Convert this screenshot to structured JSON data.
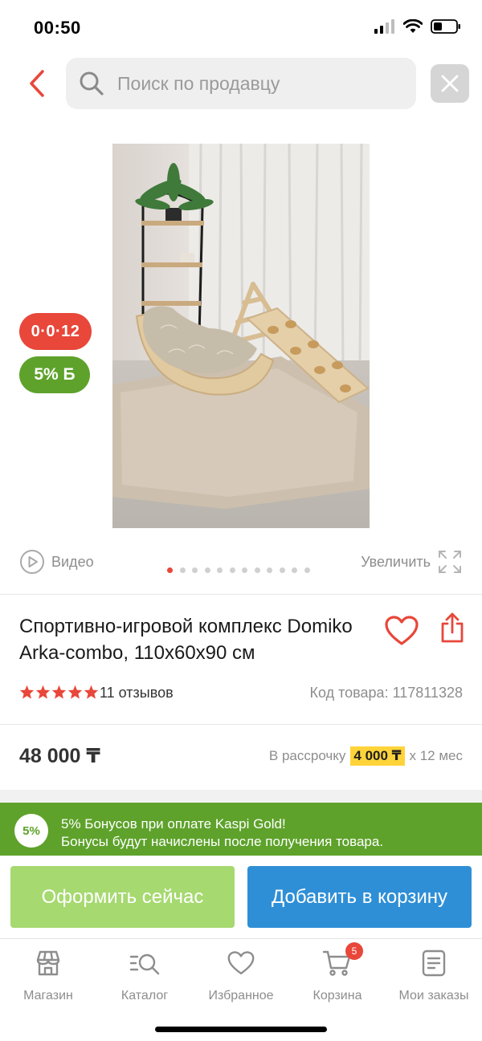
{
  "status_bar": {
    "time": "00:50"
  },
  "search": {
    "placeholder": "Поиск по продавцу"
  },
  "badges": {
    "installment": "0·0·12",
    "bonus": "5% Б"
  },
  "media": {
    "video_label": "Видео",
    "zoom_label": "Увеличить",
    "dots_count": 12,
    "active_dot": 0
  },
  "product": {
    "title": "Спортивно-игровой комплекс Domiko Arka-combo, 110x60x90 см",
    "rating_stars": 5,
    "reviews": "11 отзывов",
    "sku": "Код товара: 117811328",
    "price": "48 000 ₸",
    "installment_prefix": "В рассрочку",
    "installment_amount": "4 000 ₸",
    "installment_suffix": "x 12 мес"
  },
  "bonus_banner": {
    "circle": "5%",
    "line1": "5% Бонусов при оплате Kaspi Gold!",
    "line2": "Бонусы будут начислены после получения товара."
  },
  "actions": {
    "order_now": "Оформить сейчас",
    "add_to_cart": "Добавить в корзину"
  },
  "tabbar": {
    "items": [
      {
        "label": "Магазин",
        "icon": "store-icon"
      },
      {
        "label": "Каталог",
        "icon": "catalog-icon"
      },
      {
        "label": "Избранное",
        "icon": "heart-icon"
      },
      {
        "label": "Корзина",
        "icon": "cart-icon",
        "badge": "5"
      },
      {
        "label": "Мои заказы",
        "icon": "orders-icon"
      }
    ]
  },
  "colors": {
    "accent_red": "#e8473a",
    "bonus_green": "#5ea22b",
    "cart_blue": "#2f8fd6",
    "order_green": "#a6d970",
    "highlight_yellow": "#ffd43a"
  }
}
